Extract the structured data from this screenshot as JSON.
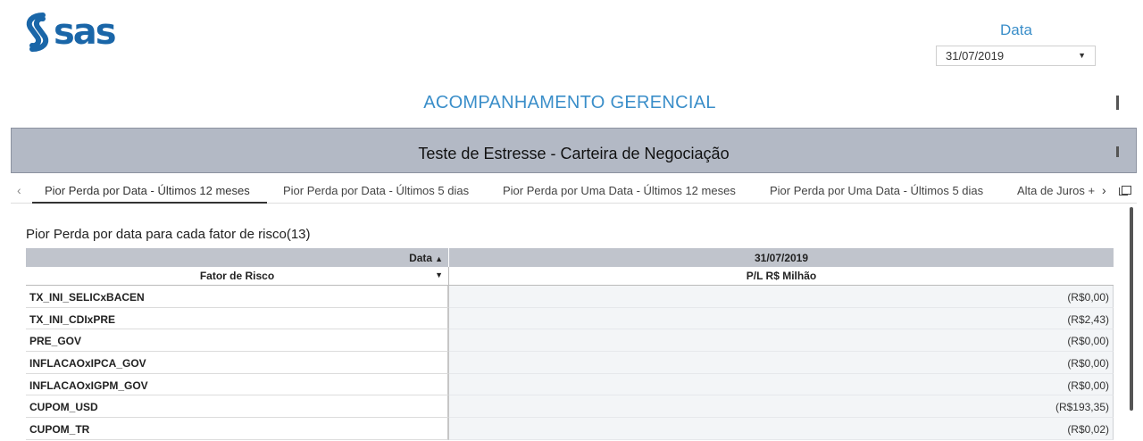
{
  "brand": {
    "logo_text": "sas",
    "accent_color": "#1a66a8"
  },
  "filter": {
    "label": "Data",
    "selected": "31/07/2019"
  },
  "page": {
    "title": "ACOMPANHAMENTO GERENCIAL"
  },
  "banner": {
    "title": "Teste de Estresse - Carteira de Negociação"
  },
  "tabs": [
    {
      "label": "Pior Perda por Data - Últimos 12 meses",
      "active": true
    },
    {
      "label": "Pior Perda por Data - Últimos 5 dias",
      "active": false
    },
    {
      "label": "Pior Perda por Uma Data - Últimos 12 meses",
      "active": false
    },
    {
      "label": "Pior Perda por Uma Data - Últimos 5 dias",
      "active": false
    },
    {
      "label": "Alta de Juros +",
      "active": false
    }
  ],
  "table": {
    "title": "Pior Perda por data para cada fator de risco(13)",
    "header_row1": {
      "left": "Data",
      "right": "31/07/2019"
    },
    "header_row2": {
      "left": "Fator de Risco",
      "right": "P/L  R$ Milhão"
    },
    "rows": [
      {
        "factor": "TX_INI_SELICxBACEN",
        "value": "(R$0,00)"
      },
      {
        "factor": "TX_INI_CDIxPRE",
        "value": "(R$2,43)"
      },
      {
        "factor": "PRE_GOV",
        "value": "(R$0,00)"
      },
      {
        "factor": "INFLACAOxIPCA_GOV",
        "value": "(R$0,00)"
      },
      {
        "factor": "INFLACAOxIGPM_GOV",
        "value": "(R$0,00)"
      },
      {
        "factor": "CUPOM_USD",
        "value": "(R$193,35)"
      },
      {
        "factor": "CUPOM_TR",
        "value": "(R$0,02)"
      }
    ]
  }
}
